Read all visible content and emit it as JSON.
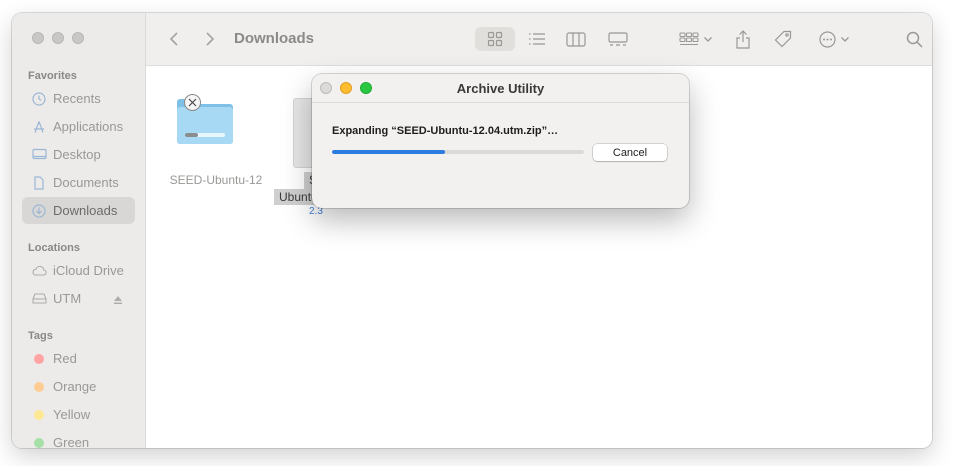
{
  "finder": {
    "path_title": "Downloads",
    "sidebar": {
      "favorites_title": "Favorites",
      "favorites": [
        {
          "label": "Recents",
          "icon": "clock-icon"
        },
        {
          "label": "Applications",
          "icon": "applications-icon"
        },
        {
          "label": "Desktop",
          "icon": "desktop-icon"
        },
        {
          "label": "Documents",
          "icon": "document-icon"
        },
        {
          "label": "Downloads",
          "icon": "download-icon",
          "selected": true
        }
      ],
      "locations_title": "Locations",
      "locations": [
        {
          "label": "iCloud Drive",
          "icon": "cloud-icon"
        },
        {
          "label": "UTM",
          "icon": "drive-icon"
        }
      ],
      "tags_title": "Tags",
      "tags": [
        {
          "label": "Red",
          "color": "#ff8a8a"
        },
        {
          "label": "Orange",
          "color": "#ffc27a"
        },
        {
          "label": "Yellow",
          "color": "#fde37a"
        },
        {
          "label": "Green",
          "color": "#8fdc93"
        }
      ]
    },
    "files": [
      {
        "name": "SEED-Ubuntu-12",
        "type": "folder",
        "extracting": true
      },
      {
        "name_line1": "SE",
        "name_line2": "Ubuntu-",
        "size_partial": "2.3",
        "type": "archive",
        "selected": true
      }
    ]
  },
  "dialog": {
    "title": "Archive Utility",
    "message": "Expanding “SEED-Ubuntu-12.04.utm.zip”…",
    "progress_fraction": 0.45,
    "cancel_label": "Cancel",
    "accent_color": "#2b7de0"
  }
}
